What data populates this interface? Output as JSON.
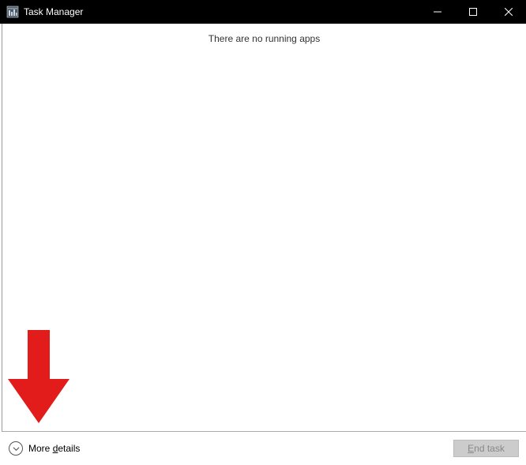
{
  "titlebar": {
    "title": "Task Manager"
  },
  "content": {
    "empty_message": "There are no running apps"
  },
  "footer": {
    "more_details_prefix": "More ",
    "more_details_underline": "d",
    "more_details_suffix": "etails",
    "end_task_underline": "E",
    "end_task_suffix": "nd task"
  }
}
